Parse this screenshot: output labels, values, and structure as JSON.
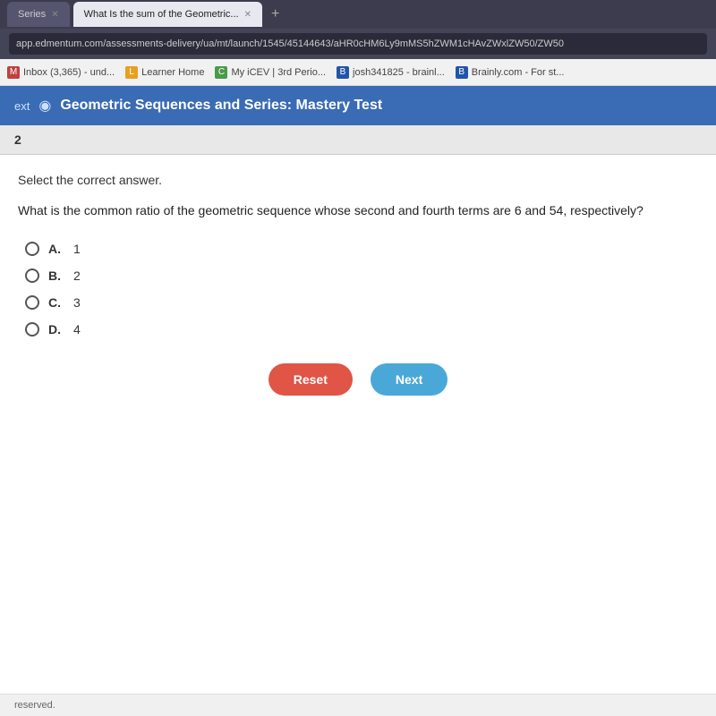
{
  "browser": {
    "tabs": [
      {
        "id": "tab1",
        "label": "Series",
        "active": false
      },
      {
        "id": "tab2",
        "label": "What Is the sum of the Geometric...",
        "active": true
      },
      {
        "id": "tab3",
        "label": "+",
        "add": true
      }
    ],
    "address": "app.edmentum.com/assessments-delivery/ua/mt/launch/1545/45144643/aHR0cHM6Ly9mMS5hZWM1cHAvZWxlZW50/ZW50",
    "bookmarks": [
      {
        "id": "bm1",
        "label": "Inbox (3,365) - und...",
        "icon": "M"
      },
      {
        "id": "bm2",
        "label": "Learner Home",
        "icon": "L"
      },
      {
        "id": "bm3",
        "label": "My iCEV | 3rd Perio...",
        "icon": "C"
      },
      {
        "id": "bm4",
        "label": "josh341825 - brainl...",
        "icon": "B"
      },
      {
        "id": "bm5",
        "label": "Brainly.com - For st...",
        "icon": "B"
      }
    ]
  },
  "page_header": {
    "back_label": "ext",
    "dot": "◉",
    "title": "Geometric Sequences and Series: Mastery Test"
  },
  "question": {
    "number": "2",
    "instruction": "Select the correct answer.",
    "text": "What is the common ratio of the geometric sequence whose second and fourth terms are 6 and 54, respectively?",
    "options": [
      {
        "id": "A",
        "value": "1"
      },
      {
        "id": "B",
        "value": "2"
      },
      {
        "id": "C",
        "value": "3"
      },
      {
        "id": "D",
        "value": "4"
      }
    ]
  },
  "buttons": {
    "reset_label": "Reset",
    "next_label": "Next"
  },
  "footer": {
    "text": "reserved."
  }
}
